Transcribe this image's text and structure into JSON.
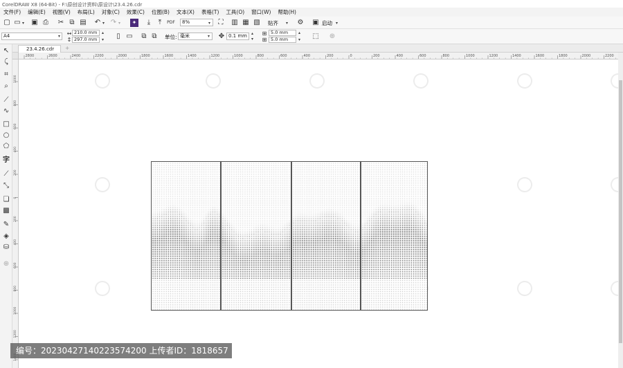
{
  "window": {
    "title": "CorelDRAW X8 (64-Bit) - F:\\原创设计资料\\原设计\\23.4.26.cdr"
  },
  "menu": {
    "items": [
      "文件(F)",
      "编辑(E)",
      "视图(V)",
      "布局(L)",
      "对象(C)",
      "效果(C)",
      "位图(B)",
      "文本(X)",
      "表格(T)",
      "工具(O)",
      "窗口(W)",
      "帮助(H)"
    ]
  },
  "toolbar": {
    "zoom_value": "8%",
    "snap_label": "贴齐",
    "launch_label": "启动"
  },
  "propbar": {
    "page_size": "A4",
    "width": "210.0 mm",
    "height": "297.0 mm",
    "units_label": "单位:",
    "units_value": "毫米",
    "nudge": "0.1 mm",
    "dup_x": "5.0 mm",
    "dup_y": "5.0 mm"
  },
  "document": {
    "tab_label": "23.4.26.cdr",
    "add_tab": "+"
  },
  "ruler": {
    "h_ticks": [
      "2800",
      "2600",
      "2400",
      "2200",
      "2000",
      "1800",
      "1600",
      "1400",
      "1200",
      "1000",
      "800",
      "600",
      "400",
      "200",
      "0",
      "200",
      "400",
      "600",
      "800",
      "1000",
      "1200",
      "1400",
      "1600",
      "1800",
      "2000",
      "2200"
    ],
    "v_ticks": [
      "1000",
      "800",
      "600",
      "400",
      "200",
      "0",
      "200",
      "400",
      "600",
      "800",
      "1000",
      "1200",
      "1400"
    ]
  },
  "canvas": {
    "panel_count": 4,
    "panel_border_color": "#555555",
    "dot_color": "#333333"
  },
  "watermark": {
    "text": "编号：20230427140223574200  上传者ID：1818657"
  },
  "icons": [
    "new-icon",
    "open-icon",
    "save-icon",
    "print-icon",
    "undo-icon",
    "redo-icon",
    "import-icon",
    "export-icon",
    "pdf-icon",
    "fullscreen-icon",
    "gear-icon",
    "pick-tool-icon",
    "shape-tool-icon",
    "crop-tool-icon",
    "zoom-tool-icon",
    "freehand-tool-icon",
    "artistic-media-icon",
    "rectangle-tool-icon",
    "ellipse-tool-icon",
    "polygon-tool-icon",
    "text-tool-icon",
    "parallel-dimension-icon",
    "connector-tool-icon",
    "drop-shadow-icon",
    "transparency-icon",
    "eyedropper-icon",
    "fill-tool-icon",
    "smart-fill-icon",
    "add-tool-icon"
  ]
}
